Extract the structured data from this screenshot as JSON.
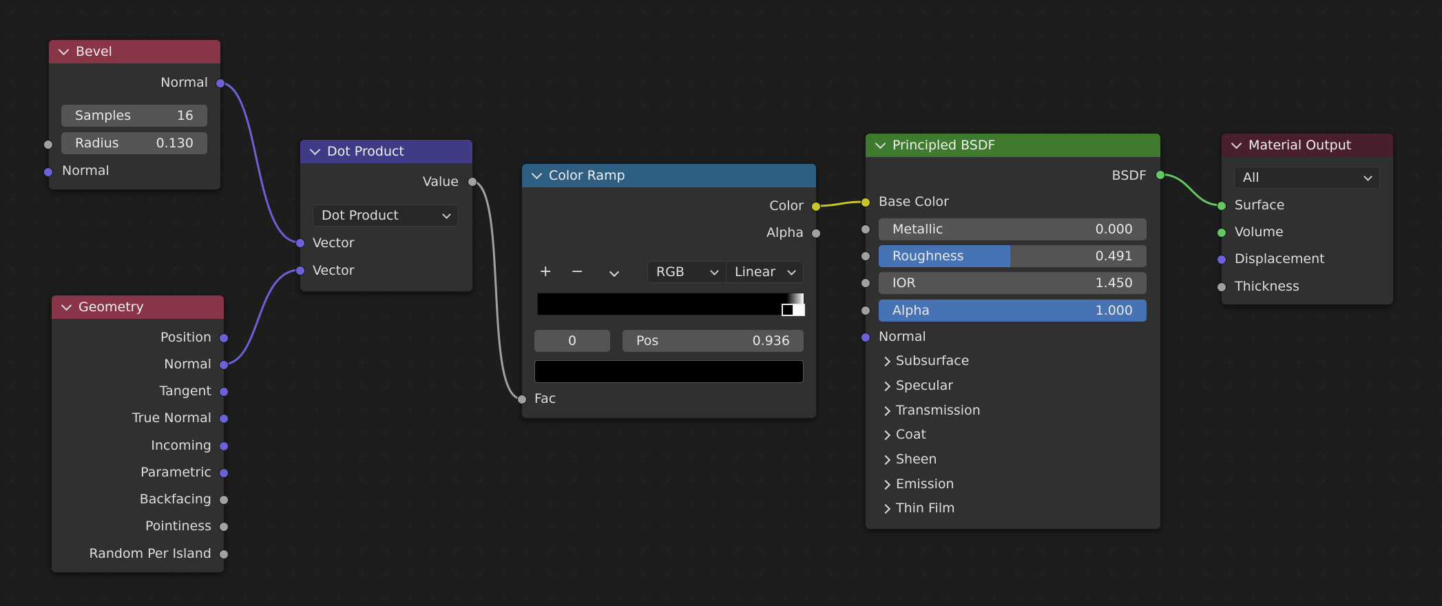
{
  "colors": {
    "bevel_header": "#8a3448",
    "geometry_header": "#8a3448",
    "dot_header": "#3f3b86",
    "colorramp_header": "#2f5e83",
    "bsdf_header": "#3e7b2f",
    "output_header": "#4a1f2c",
    "vector_socket": "#6b62d6",
    "float_socket": "#a1a1a1",
    "color_socket": "#c7c729",
    "shader_socket": "#63c763"
  },
  "bevel": {
    "title": "Bevel",
    "out_normal": "Normal",
    "samples_label": "Samples",
    "samples_value": "16",
    "radius_label": "Radius",
    "radius_value": "0.130",
    "in_normal": "Normal"
  },
  "geometry": {
    "title": "Geometry",
    "outputs": [
      "Position",
      "Normal",
      "Tangent",
      "True Normal",
      "Incoming",
      "Parametric",
      "Backfacing",
      "Pointiness",
      "Random Per Island"
    ]
  },
  "dot": {
    "title": "Dot Product",
    "out_value": "Value",
    "operation": "Dot Product",
    "in1": "Vector",
    "in2": "Vector"
  },
  "ramp": {
    "title": "Color Ramp",
    "out_color": "Color",
    "out_alpha": "Alpha",
    "add": "+",
    "remove": "−",
    "mode": "RGB",
    "interp": "Linear",
    "index": "0",
    "pos_label": "Pos",
    "pos_value": "0.936",
    "in_fac": "Fac"
  },
  "bsdf": {
    "title": "Principled BSDF",
    "out_bsdf": "BSDF",
    "base_color": "Base Color",
    "metallic_label": "Metallic",
    "metallic_value": "0.000",
    "roughness_label": "Roughness",
    "roughness_value": "0.491",
    "roughness_fraction": 0.491,
    "ior_label": "IOR",
    "ior_value": "1.450",
    "alpha_label": "Alpha",
    "alpha_value": "1.000",
    "alpha_fraction": 1.0,
    "normal": "Normal",
    "panels": [
      "Subsurface",
      "Specular",
      "Transmission",
      "Coat",
      "Sheen",
      "Emission",
      "Thin Film"
    ]
  },
  "output": {
    "title": "Material Output",
    "target": "All",
    "inputs": [
      "Surface",
      "Volume",
      "Displacement",
      "Thickness"
    ]
  }
}
